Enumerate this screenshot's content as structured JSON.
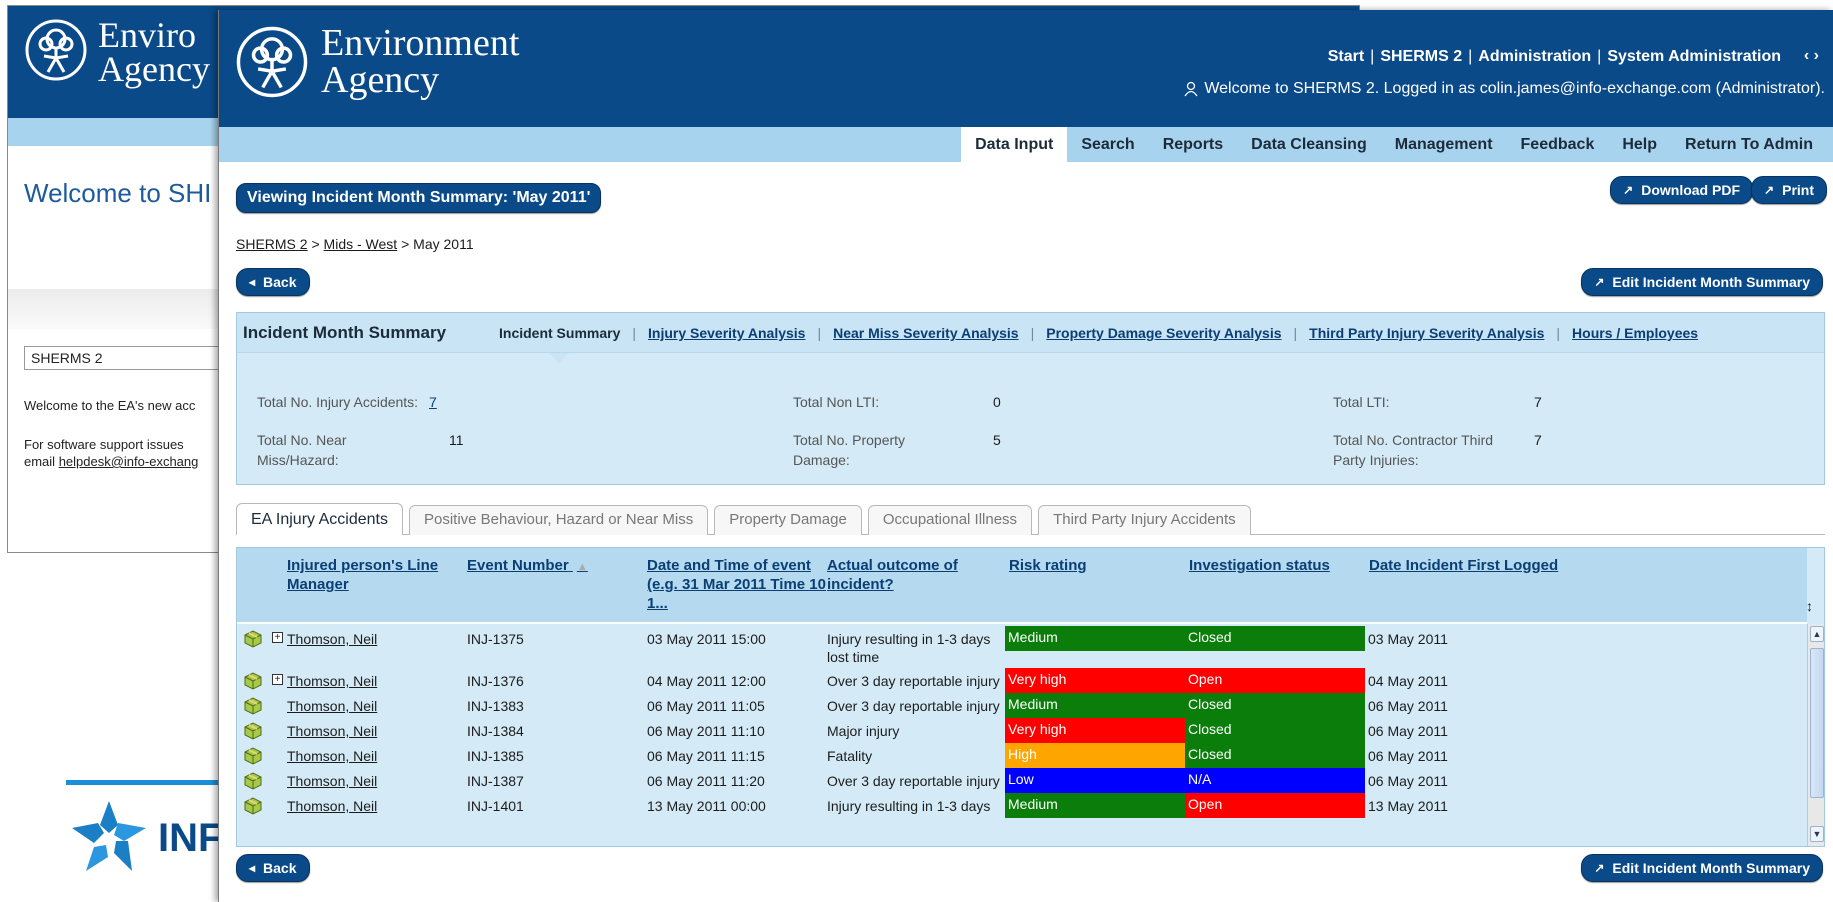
{
  "colors": {
    "brand_blue": "#0b4a88",
    "light_blue": "#a8d3ee",
    "panel_blue": "#d4ebf7",
    "risk_medium": "#0a7d0a",
    "risk_very_high": "#ff0000",
    "risk_high": "#ffa500",
    "risk_low": "#0000ff",
    "status_closed": "#0a7d0a",
    "status_open": "#ff0000",
    "status_na": "#0000ff"
  },
  "background_window": {
    "logo_line1": "Enviro",
    "logo_line2": "Agency",
    "welcome": "Welcome to SHI",
    "box_value": "SHERMS 2",
    "text1": "Welcome to the EA's new acc",
    "text2_line1": "For software support issues",
    "text2_line2_prefix": "email ",
    "text2_link": "helpdesk@info-exchang",
    "infx_logo": "INF"
  },
  "header": {
    "logo_line1": "Environment",
    "logo_line2": "Agency",
    "nav": [
      "Start",
      "SHERMS 2",
      "Administration",
      "System Administration"
    ],
    "nav_sep": "|",
    "arrows": "‹ ›",
    "welcome": "Welcome to SHERMS 2. Logged in as colin.james@info-exchange.com (Administrator)."
  },
  "menu": [
    "Data Input",
    "Search",
    "Reports",
    "Data Cleansing",
    "Management",
    "Feedback",
    "Help",
    "Return To Admin"
  ],
  "page": {
    "title": "Viewing Incident Month Summary: 'May 2011'",
    "download_pdf": "Download PDF",
    "print": "Print",
    "back": "Back",
    "edit": "Edit Incident Month Summary",
    "breadcrumb": [
      "SHERMS 2",
      "Mids - West",
      "May 2011"
    ],
    "breadcrumb_sep": ">"
  },
  "summary": {
    "title": "Incident Month Summary",
    "tabs": [
      "Incident Summary",
      "Injury Severity Analysis",
      "Near Miss Severity Analysis",
      "Property Damage Severity Analysis",
      "Third Party Injury Severity Analysis",
      "Hours / Employees"
    ],
    "tab_sep": "|",
    "fields": {
      "injury_accidents_label": "Total No. Injury Accidents:",
      "injury_accidents_value": "7",
      "non_lti_label": "Total Non LTI:",
      "non_lti_value": "0",
      "lti_label": "Total LTI:",
      "lti_value": "7",
      "near_miss_label_1": "Total No. Near",
      "near_miss_label_2": "Miss/Hazard:",
      "near_miss_value": "11",
      "property_label_1": "Total No. Property",
      "property_label_2": "Damage:",
      "property_value": "5",
      "contractor_label_1": "Total No. Contractor Third",
      "contractor_label_2": "Party Injuries:",
      "contractor_value": "7"
    }
  },
  "tabs": [
    "EA Injury Accidents",
    "Positive Behaviour, Hazard or Near Miss",
    "Property Damage",
    "Occupational Illness",
    "Third Party Injury Accidents"
  ],
  "table": {
    "headers": {
      "manager_1": "Injured person's Line",
      "manager_2": "Manager",
      "event": "Event Number",
      "date_1": "Date and Time of event",
      "date_2": "(e.g. 31 Mar 2011 Time 10",
      "date_3": "1...",
      "outcome_1": "Actual outcome of",
      "outcome_2": "incident?",
      "risk": "Risk rating",
      "status": "Investigation status",
      "logged": "Date Incident First Logged"
    },
    "sort_indicator": "▲",
    "resize_indicator": "↕",
    "rows": [
      {
        "manager": "Thomson, Neil",
        "event": "INJ-1375",
        "date": "03 May 2011 15:00",
        "outcome_1": "Injury resulting in 1-3 days",
        "outcome_2": "lost time",
        "risk": "Medium",
        "status": "Closed",
        "logged": "03 May 2011"
      },
      {
        "manager": "Thomson, Neil",
        "event": "INJ-1376",
        "date": "04 May 2011 12:00",
        "outcome_1": "Over 3 day reportable injury",
        "outcome_2": "",
        "risk": "Very high",
        "status": "Open",
        "logged": "04 May 2011"
      },
      {
        "manager": "Thomson, Neil",
        "event": "INJ-1383",
        "date": "06 May 2011 11:05",
        "outcome_1": "Over 3 day reportable injury",
        "outcome_2": "",
        "risk": "Medium",
        "status": "Closed",
        "logged": "06 May 2011"
      },
      {
        "manager": "Thomson, Neil",
        "event": "INJ-1384",
        "date": "06 May 2011 11:10",
        "outcome_1": "Major injury",
        "outcome_2": "",
        "risk": "Very high",
        "status": "Closed",
        "logged": "06 May 2011"
      },
      {
        "manager": "Thomson, Neil",
        "event": "INJ-1385",
        "date": "06 May 2011 11:15",
        "outcome_1": "Fatality",
        "outcome_2": "",
        "risk": "High",
        "status": "Closed",
        "logged": "06 May 2011"
      },
      {
        "manager": "Thomson, Neil",
        "event": "INJ-1387",
        "date": "06 May 2011 11:20",
        "outcome_1": "Over 3 day reportable injury",
        "outcome_2": "",
        "risk": "Low",
        "status": "N/A",
        "logged": "06 May 2011"
      },
      {
        "manager": "Thomson, Neil",
        "event": "INJ-1401",
        "date": "13 May 2011 00:00",
        "outcome_1": "Injury resulting in 1-3 days",
        "outcome_2": "",
        "risk": "Medium",
        "status": "Open",
        "logged": "13 May 2011"
      }
    ]
  }
}
